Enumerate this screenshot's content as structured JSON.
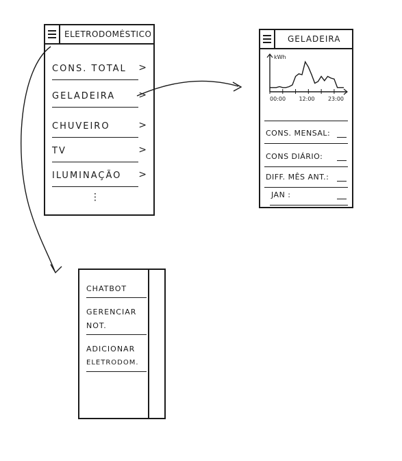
{
  "menu_screen": {
    "title": "ELETRODOMÉSTICOS",
    "items": [
      {
        "label": "CONS. TOTAL",
        "chevron": ">"
      },
      {
        "label": "GELADEIRA",
        "chevron": ">"
      },
      {
        "label": "CHUVEIRO",
        "chevron": ">"
      },
      {
        "label": "TV",
        "chevron": ">"
      },
      {
        "label": "ILUMINAÇÃO",
        "chevron": ">"
      }
    ],
    "more": "⋮"
  },
  "detail_screen": {
    "title": "GELADEIRA",
    "chart": {
      "y_label": "kWh",
      "x_ticks": [
        "00:00",
        "12:00",
        "23:00"
      ]
    },
    "fields": [
      {
        "label": "CONS. MENSAL:"
      },
      {
        "label": "CONS DIÁRIO:"
      },
      {
        "label": "DIFF. MÊS ANT.:"
      },
      {
        "label": "JAN :"
      }
    ]
  },
  "drawer": {
    "items": [
      {
        "line1": "CHATBOT",
        "line2": ""
      },
      {
        "line1": "GERENCIAR",
        "line2": "NOT."
      },
      {
        "line1": "ADICIONAR",
        "line2": "ELETRODOM."
      }
    ]
  },
  "chart_data": {
    "type": "line",
    "x_ticks": [
      "00:00",
      "12:00",
      "23:00"
    ],
    "ylabel": "kWh",
    "series": [
      {
        "values": [
          0.5,
          0.5,
          0.5,
          0.6,
          0.5,
          0.5,
          0.6,
          0.8,
          1.8,
          2.1,
          2.0,
          3.5,
          2.9,
          2.0,
          1.0,
          1.2,
          1.8,
          1.3,
          1.8,
          1.6,
          1.5,
          0.5,
          0.5,
          0.5
        ]
      }
    ]
  }
}
